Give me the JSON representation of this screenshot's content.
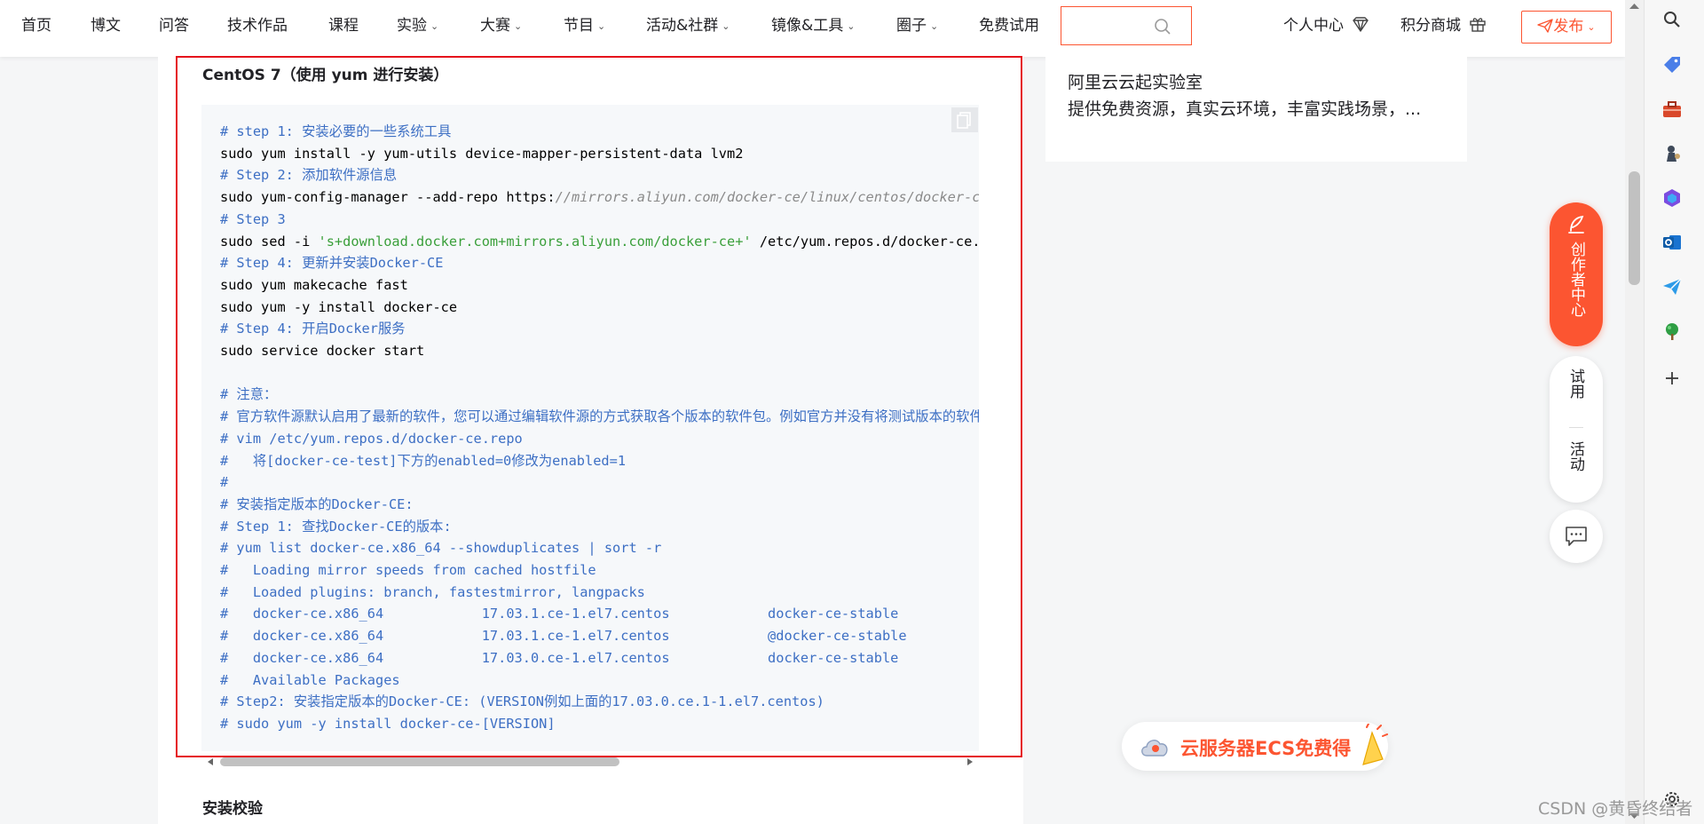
{
  "nav": {
    "items": [
      "首页",
      "博文",
      "问答",
      "技术作品",
      "课程",
      "实验",
      "大赛",
      "节目",
      "活动&社群",
      "镜像&工具",
      "圈子",
      "免费试用"
    ],
    "search_placeholder": "",
    "personal_center": "个人中心",
    "points_mall": "积分商城",
    "publish": "发布"
  },
  "article": {
    "section_heading": "CentOS 7（使用 yum 进行安装）",
    "code_lines": [
      {
        "t": "c",
        "parts": [
          "# step 1: 安装必要的一些系统工具"
        ]
      },
      {
        "t": "p",
        "parts": [
          "sudo yum install -y yum-utils device-mapper-persistent-data lvm2"
        ]
      },
      {
        "t": "c",
        "parts": [
          "# Step 2: 添加软件源信息"
        ]
      },
      {
        "t": "u",
        "parts": [
          "sudo yum-config-manager --add-repo https:",
          "//mirrors.aliyun.com/docker-ce/linux/centos/docker-ce.repo"
        ]
      },
      {
        "t": "c",
        "parts": [
          "# Step 3"
        ]
      },
      {
        "t": "s",
        "parts": [
          "sudo sed -i ",
          "'s+download.docker.com+mirrors.aliyun.com/docker-ce+'",
          " /etc/yum.repos.d/docker-ce.repo"
        ]
      },
      {
        "t": "c",
        "parts": [
          "# Step 4: 更新并安装Docker-CE"
        ]
      },
      {
        "t": "p",
        "parts": [
          "sudo yum makecache fast"
        ]
      },
      {
        "t": "p",
        "parts": [
          "sudo yum -y install docker-ce"
        ]
      },
      {
        "t": "c",
        "parts": [
          "# Step 4: 开启Docker服务"
        ]
      },
      {
        "t": "p",
        "parts": [
          "sudo service docker start"
        ]
      },
      {
        "t": "b",
        "parts": [
          ""
        ]
      },
      {
        "t": "c",
        "parts": [
          "# 注意："
        ]
      },
      {
        "t": "c",
        "parts": [
          "# 官方软件源默认启用了最新的软件，您可以通过编辑软件源的方式获取各个版本的软件包。例如官方并没有将测试版本的软件源置为可用"
        ]
      },
      {
        "t": "c",
        "parts": [
          "# vim /etc/yum.repos.d/docker-ce.repo"
        ]
      },
      {
        "t": "c",
        "parts": [
          "#   将[docker-ce-test]下方的enabled=0修改为enabled=1"
        ]
      },
      {
        "t": "c",
        "parts": [
          "#"
        ]
      },
      {
        "t": "c",
        "parts": [
          "# 安装指定版本的Docker-CE:"
        ]
      },
      {
        "t": "c",
        "parts": [
          "# Step 1: 查找Docker-CE的版本:"
        ]
      },
      {
        "t": "c",
        "parts": [
          "# yum list docker-ce.x86_64 --showduplicates | sort -r"
        ]
      },
      {
        "t": "c",
        "parts": [
          "#   Loading mirror speeds from cached hostfile"
        ]
      },
      {
        "t": "c",
        "parts": [
          "#   Loaded plugins: branch, fastestmirror, langpacks"
        ]
      },
      {
        "t": "c",
        "parts": [
          "#   docker-ce.x86_64            17.03.1.ce-1.el7.centos            docker-ce-stable"
        ]
      },
      {
        "t": "c",
        "parts": [
          "#   docker-ce.x86_64            17.03.1.ce-1.el7.centos            @docker-ce-stable"
        ]
      },
      {
        "t": "c",
        "parts": [
          "#   docker-ce.x86_64            17.03.0.ce-1.el7.centos            docker-ce-stable"
        ]
      },
      {
        "t": "c",
        "parts": [
          "#   Available Packages"
        ]
      },
      {
        "t": "c",
        "parts": [
          "# Step2: 安装指定版本的Docker-CE: (VERSION例如上面的17.03.0.ce.1-1.el7.centos)"
        ]
      },
      {
        "t": "c",
        "parts": [
          "# sudo yum -y install docker-ce-[VERSION]"
        ]
      }
    ],
    "next_heading": "安装校验"
  },
  "side_card": {
    "title": "阿里云云起实验室",
    "desc": "提供免费资源，真实云环境，丰富实践场景，..."
  },
  "floating": {
    "creator_center": "创作者中心",
    "trial": "试用",
    "activity": "活动",
    "ecs_banner": "云服务器ECS免费得"
  },
  "watermark": "CSDN @黄昏终结者",
  "colors": {
    "accent": "#fc5531",
    "highlight_box": "#e5121c",
    "code_comment": "#3d6fc4",
    "code_string": "#3a9f3a"
  },
  "icons": [
    "search-icon",
    "gem-icon",
    "gift-icon",
    "send-icon",
    "copy-icon",
    "pen-icon",
    "chat-icon",
    "cloud-icon",
    "edge-search-icon",
    "edge-tag-icon",
    "edge-toolbox-icon",
    "edge-chess-icon",
    "edge-office-icon",
    "edge-outlook-icon",
    "edge-send-icon",
    "edge-tree-icon",
    "edge-add-icon",
    "edge-settings-icon"
  ]
}
